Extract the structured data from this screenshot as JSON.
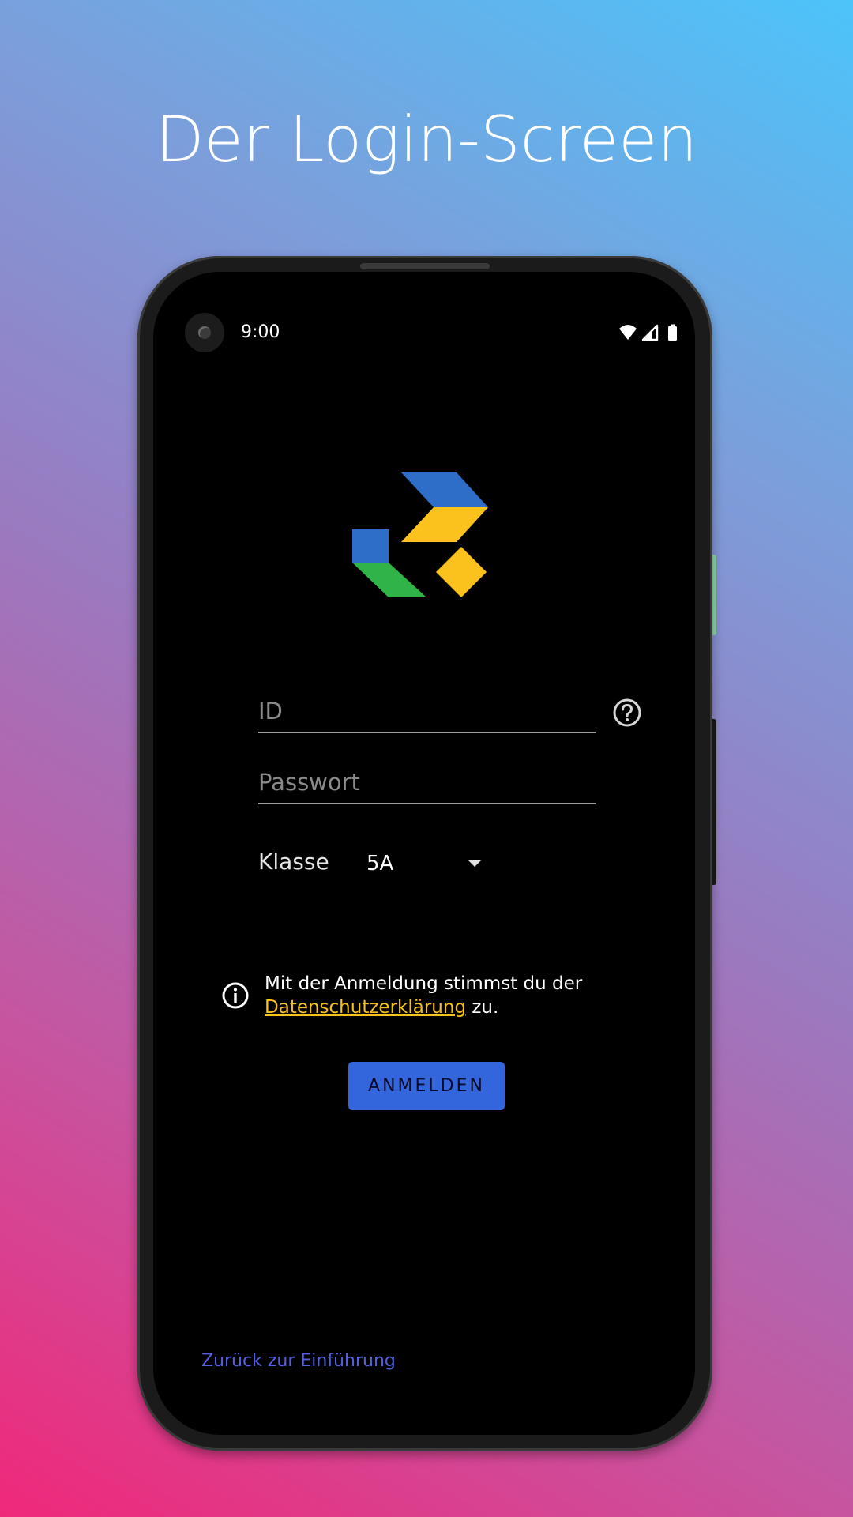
{
  "headline": "Der Login-Screen",
  "status_bar": {
    "time": "9:00",
    "icons": [
      "wifi-icon",
      "cell-signal-icon",
      "battery-icon"
    ]
  },
  "logo": {
    "colors": {
      "blue": "#2f6ec8",
      "yellow": "#fbc21d",
      "green": "#31b447"
    }
  },
  "form": {
    "id_placeholder": "ID",
    "password_placeholder": "Passwort",
    "class_label": "Klasse",
    "class_value": "5A"
  },
  "consent": {
    "text_before": "Mit der Anmeldung stimmst du der",
    "link_text": "Datenschutzerklärung",
    "text_after": " zu."
  },
  "login_button": "ANMELDEN",
  "back_link": "Zurück zur Einführung",
  "colors": {
    "accent_button": "#3366dd",
    "link_yellow": "#f8c21a",
    "back_link": "#5560e0",
    "screen_bg": "#000000"
  }
}
